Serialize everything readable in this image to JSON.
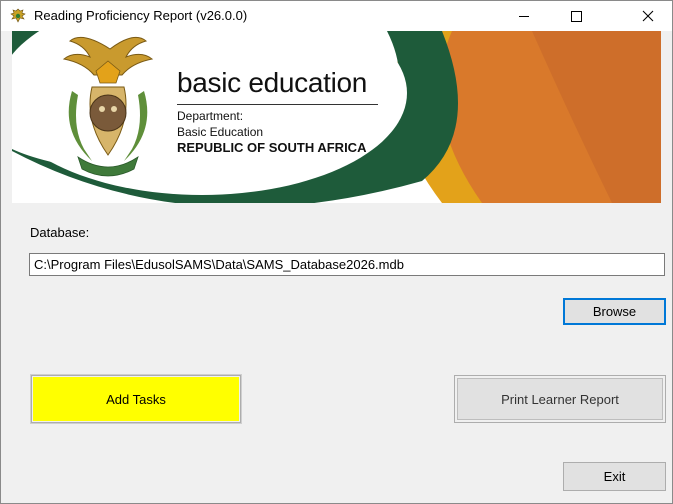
{
  "window": {
    "title": "Reading Proficiency Report (v26.0.0)",
    "app_icon": "coat-of-arms-icon",
    "controls": {
      "minimize_icon": "minimize-icon",
      "maximize_icon": "maximize-icon",
      "close_icon": "close-icon"
    }
  },
  "banner": {
    "brand": "basic education",
    "department_line1": "Department:",
    "department_line2": "Basic Education",
    "country": "REPUBLIC OF SOUTH AFRICA",
    "colors": {
      "green": "#1e5b3a",
      "orange": "#d9792b",
      "gold": "#e3a21a"
    }
  },
  "form": {
    "database_label": "Database:",
    "database_path": "C:\\Program Files\\EdusolSAMS\\Data\\SAMS_Database2026.mdb",
    "browse_label": "Browse",
    "add_tasks_label": "Add Tasks",
    "print_report_label": "Print Learner Report",
    "exit_label": "Exit",
    "add_tasks_color": "#ffff00"
  }
}
